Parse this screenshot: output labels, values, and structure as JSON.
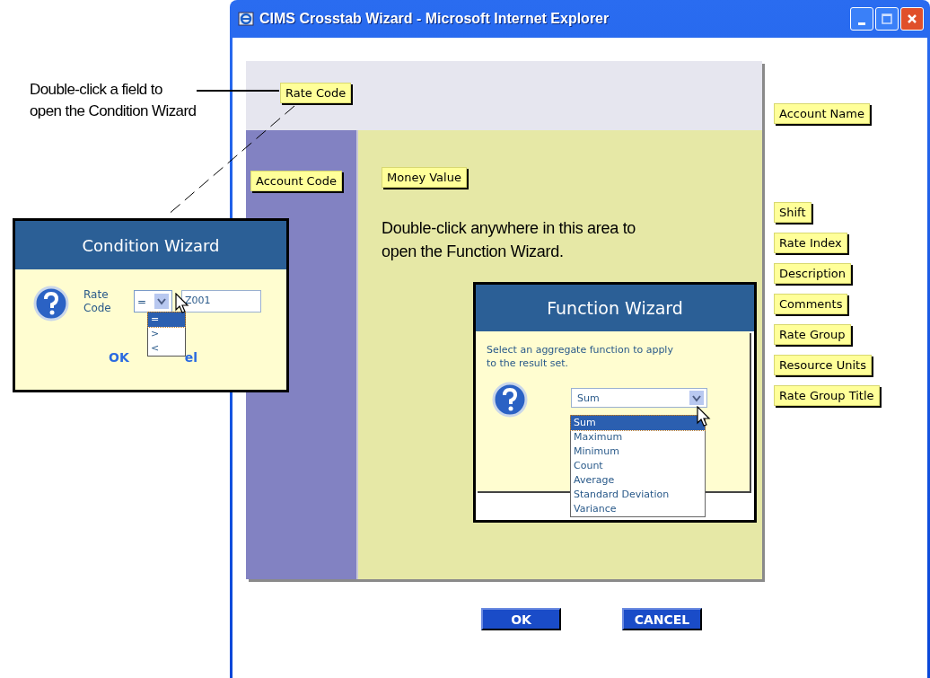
{
  "window": {
    "title": "CIMS Crosstab Wizard - Microsoft Internet Explorer"
  },
  "callout": {
    "text": "Double-click a field to\nopen the Condition Wizard"
  },
  "row_field": {
    "label": "Rate Code"
  },
  "column_field": {
    "label": "Account Code"
  },
  "data_field": {
    "label": "Money Value"
  },
  "hint": "Double-click anywhere in this area to\nopen the Function Wizard.",
  "available_fields": [
    {
      "label": "Account Name"
    },
    {
      "label": "Shift"
    },
    {
      "label": "Rate Index"
    },
    {
      "label": "Description"
    },
    {
      "label": "Comments"
    },
    {
      "label": "Rate Group"
    },
    {
      "label": "Resource Units"
    },
    {
      "label": "Rate Group Title"
    }
  ],
  "buttons": [
    {
      "label": "OK"
    },
    {
      "label": "CANCEL"
    }
  ],
  "condition_wizard": {
    "title": "Condition Wizard",
    "label": "Rate\nCode",
    "operator": "=",
    "value": "Z001",
    "operators": [
      {
        "label": "=",
        "selected": true
      },
      {
        "label": ">",
        "selected": false
      },
      {
        "label": "<",
        "selected": false
      }
    ],
    "buttons": [
      {
        "label": "OK"
      },
      {
        "label": "el"
      }
    ]
  },
  "function_wizard": {
    "title": "Function Wizard",
    "instruction": "Select an aggregate function to apply\nto the result set.",
    "function": "Sum",
    "functions": [
      {
        "label": "Sum",
        "selected": true
      },
      {
        "label": "Maximum",
        "selected": false
      },
      {
        "label": "Minimum",
        "selected": false
      },
      {
        "label": "Count",
        "selected": false
      },
      {
        "label": "Average",
        "selected": false
      },
      {
        "label": "Standard Deviation",
        "selected": false
      },
      {
        "label": "Variance",
        "selected": false
      }
    ]
  }
}
